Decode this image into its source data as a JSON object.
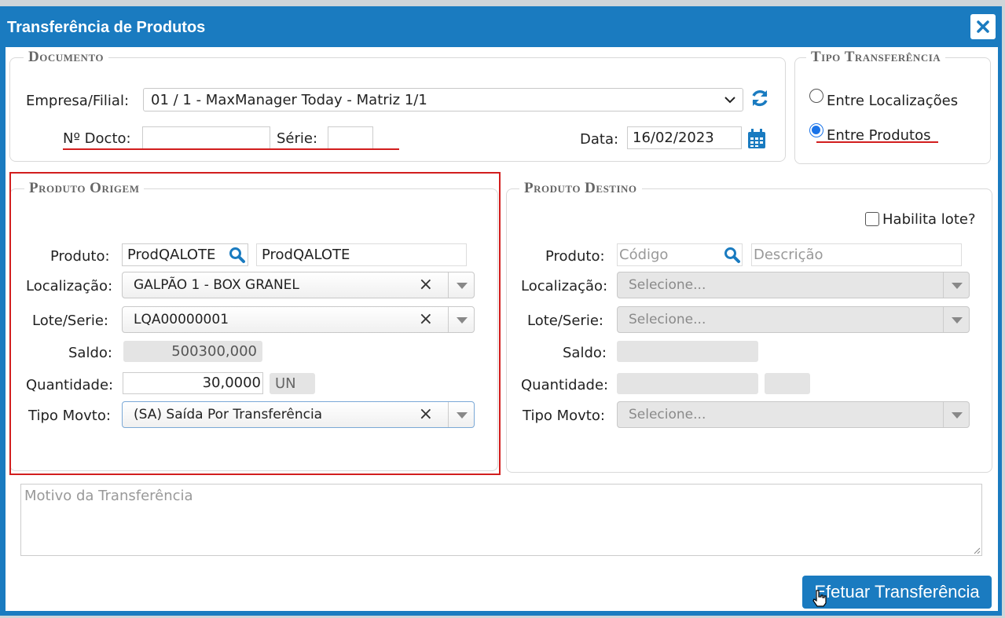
{
  "dialog": {
    "title": "Transferência de Produtos"
  },
  "documento": {
    "legend": "Documento",
    "empresa_label": "Empresa/Filial:",
    "empresa_value": "01 / 1 - MaxManager Today - Matriz 1/1",
    "ndocto_label": "Nº Docto:",
    "ndocto_value": "",
    "serie_label": "Série:",
    "serie_value": "",
    "data_label": "Data:",
    "data_value": "16/02/2023"
  },
  "tipo_transferencia": {
    "legend": "Tipo Transferência",
    "options": [
      {
        "label": "Entre Localizações",
        "selected": false
      },
      {
        "label": "Entre Produtos",
        "selected": true
      }
    ]
  },
  "produto_origem": {
    "legend": "Produto Origem",
    "produto_label": "Produto:",
    "produto_codigo": "ProdQALOTE",
    "produto_descricao": "ProdQALOTE",
    "localizacao_label": "Localização:",
    "localizacao_value": "GALPÃO 1 - BOX GRANEL",
    "lote_label": "Lote/Serie:",
    "lote_value": "LQA00000001",
    "saldo_label": "Saldo:",
    "saldo_value": "500300,000",
    "quantidade_label": "Quantidade:",
    "quantidade_value": "30,0000",
    "unidade_value": "UN",
    "tipo_movto_label": "Tipo Movto:",
    "tipo_movto_value": "(SA) Saída Por Transferência"
  },
  "produto_destino": {
    "legend": "Produto Destino",
    "habilita_lote_label": "Habilita lote?",
    "produto_label": "Produto:",
    "codigo_placeholder": "Código",
    "descricao_placeholder": "Descrição",
    "localizacao_label": "Localização:",
    "localizacao_placeholder": "Selecione...",
    "lote_label": "Lote/Serie:",
    "lote_placeholder": "Selecione...",
    "saldo_label": "Saldo:",
    "quantidade_label": "Quantidade:",
    "tipo_movto_label": "Tipo Movto:",
    "tipo_movto_placeholder": "Selecione..."
  },
  "motivo": {
    "placeholder": "Motivo da Transferência"
  },
  "actions": {
    "submit_label": "Efetuar Transferência"
  },
  "colors": {
    "primary": "#1a7bc0",
    "highlight": "#d21e1e",
    "radio": "#1a73e8"
  }
}
